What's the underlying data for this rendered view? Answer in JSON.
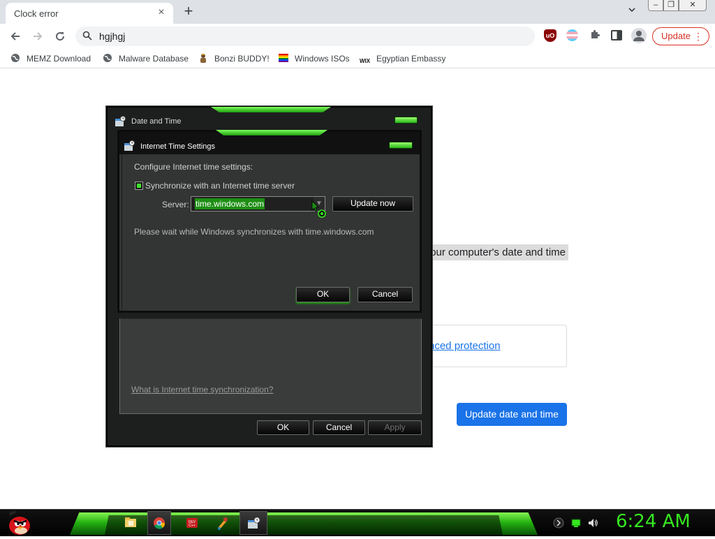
{
  "browser": {
    "tab_title": "Clock error",
    "tab_close": "×",
    "new_tab": "+",
    "address": "hgjhgj",
    "update_label": "Update",
    "update_menu": "⋮",
    "ext_ublock": "uO"
  },
  "bookmarks": [
    {
      "label": "MEMZ Download",
      "icon": "globe-icon"
    },
    {
      "label": "Malware Database",
      "icon": "globe-icon"
    },
    {
      "label": "Bonzi BUDDY!",
      "icon": "bonzi-icon"
    },
    {
      "label": "Windows ISOs",
      "icon": "rainbow-flag-icon"
    },
    {
      "label": "Egyptian Embassy",
      "icon": "wix-icon",
      "icon_text": "WIX"
    }
  ],
  "page": {
    "highlight_text": "our computer's date and time",
    "link_text": "nced protection",
    "update_button": "Update date and time"
  },
  "outer_dialog": {
    "title": "Date and Time",
    "help_link": "What is Internet time synchronization?",
    "ok": "OK",
    "cancel": "Cancel",
    "apply": "Apply"
  },
  "inner_dialog": {
    "title": "Internet Time Settings",
    "heading": "Configure Internet time settings:",
    "sync_label": "Synchronize with an Internet time server",
    "sync_checked": true,
    "server_label": "Server:",
    "server_value": "time.windows.com",
    "update_now": "Update now",
    "status": "Please wait while Windows synchronizes with time.windows.com",
    "ok": "OK",
    "cancel": "Cancel"
  },
  "taskbar": {
    "clock": "6:24 AM",
    "accent": "#35e81f",
    "apps": [
      "explorer-icon",
      "chrome-icon",
      "devcpp-icon",
      "paint-icon",
      "date-time-icon"
    ]
  },
  "colors": {
    "chrome_blue": "#1a73e8",
    "update_red": "#d93025",
    "dialog_green": "#3de52a"
  }
}
